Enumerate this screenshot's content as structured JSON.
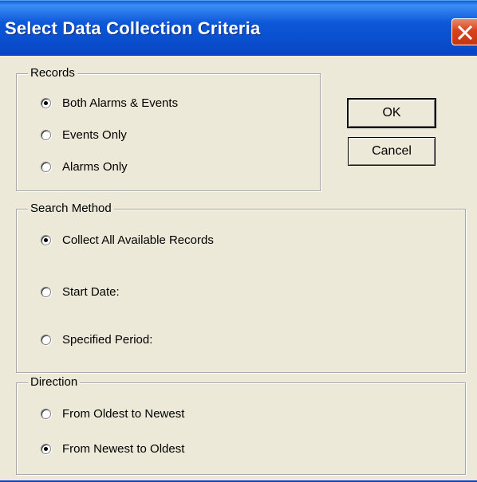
{
  "window": {
    "title": "Select Data Collection Criteria"
  },
  "buttons": {
    "ok": "OK",
    "cancel": "Cancel"
  },
  "records": {
    "legend": "Records",
    "options": [
      {
        "label": "Both Alarms & Events",
        "checked": true
      },
      {
        "label": "Events Only",
        "checked": false
      },
      {
        "label": "Alarms Only",
        "checked": false
      }
    ]
  },
  "search": {
    "legend": "Search Method",
    "options": [
      {
        "label": "Collect All Available Records",
        "checked": true
      },
      {
        "label": "Start Date:",
        "checked": false
      },
      {
        "label": "Specified Period:",
        "checked": false
      }
    ]
  },
  "direction": {
    "legend": "Direction",
    "options": [
      {
        "label": "From Oldest to Newest",
        "checked": false
      },
      {
        "label": "From Newest to Oldest",
        "checked": true
      }
    ]
  }
}
